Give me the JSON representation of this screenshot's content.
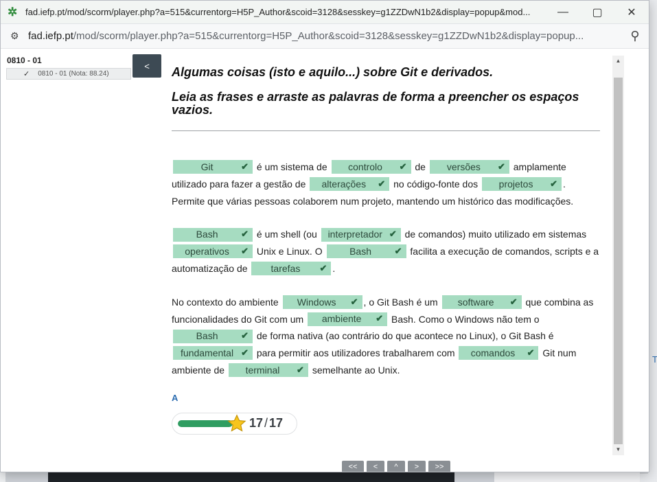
{
  "window": {
    "title": "fad.iefp.pt/mod/scorm/player.php?a=515&currentorg=H5P_Author&scoid=3128&sesskey=g1ZZDwN1b2&display=popup&mod...",
    "minimize_icon": "minimize-icon",
    "maximize_icon": "maximize-icon",
    "close_icon": "close-icon"
  },
  "address": {
    "host": "fad.iefp.pt",
    "path": "/mod/scorm/player.php?a=515&currentorg=H5P_Author&scoid=3128&sesskey=g1ZZDwN1b2&display=popup..."
  },
  "toc": {
    "heading": "0810 - 01",
    "item": "0810 - 01 (Nota: 88.24)",
    "collapse_label": "<"
  },
  "activity": {
    "title": "Algumas coisas (isto e aquilo...) sobre Git e derivados.",
    "instructions": "Leia as frases e arraste as palavras de forma a preencher os espaços vazios.",
    "p1": {
      "z1": "Git",
      "t1": " é um sistema de ",
      "z2": "controlo",
      "t2": " de ",
      "z3": "versões",
      "t3": " amplamente utilizado para fazer a gestão de ",
      "z4": "alterações",
      "t4": " no código-fonte dos ",
      "z5": "projetos",
      "t5": ". Permite que várias pessoas colaborem num projeto, mantendo um histórico das modificações."
    },
    "p2": {
      "z1": "Bash",
      "t1": " é um shell (ou ",
      "z2": "interpretador",
      "t2": " de comandos) muito utilizado em sistemas ",
      "z3": "operativos",
      "t3": " Unix e Linux. O ",
      "z4": "Bash",
      "t4": " facilita a execução de comandos, scripts e a automatização de ",
      "z5": "tarefas",
      "t5": "."
    },
    "p3": {
      "t0": "No contexto do ambiente ",
      "z1": "Windows",
      "t1": ", o Git Bash é um ",
      "z2": "software",
      "t2": " que combina as funcionalidades do Git com um ",
      "z3": "ambiente",
      "t3": " Bash. Como o Windows não tem o ",
      "z4": "Bash",
      "t4": " de forma nativa (ao contrário do que acontece no Linux), o Git Bash é ",
      "z5": "fundamental",
      "t5": " para permitir aos utilizadores trabalharem com ",
      "z6": "comandos",
      "t6": " Git num ambiente de ",
      "z7": "terminal",
      "t7": " semelhante ao Unix."
    },
    "flag": "A",
    "score": {
      "value": "17",
      "max": "17",
      "fraction": 1.0,
      "bar_color": "#2f9d61"
    }
  },
  "nav": [
    "<<",
    "<",
    "^",
    ">",
    ">>"
  ],
  "colors": {
    "chip_bg": "#a6dcc1",
    "chip_check": "#25623e",
    "toc_button": "#3d4a54"
  }
}
